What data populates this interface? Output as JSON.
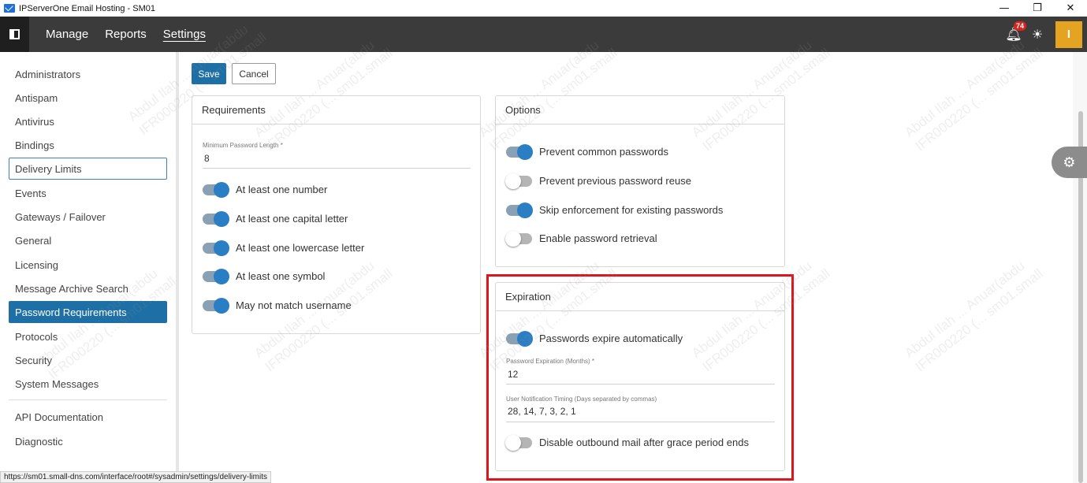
{
  "window": {
    "title": "IPServerOne Email Hosting - SM01",
    "minimize_glyph": "—",
    "maximize_glyph": "❐",
    "close_glyph": "✕"
  },
  "topnav": {
    "items": [
      {
        "label": "Manage"
      },
      {
        "label": "Reports"
      },
      {
        "label": "Settings",
        "active": true
      }
    ],
    "notification_count": "74",
    "avatar_initial": "I"
  },
  "sidebar": {
    "items": [
      {
        "label": "Administrators"
      },
      {
        "label": "Antispam"
      },
      {
        "label": "Antivirus"
      },
      {
        "label": "Bindings"
      },
      {
        "label": "Delivery Limits",
        "hovered": true
      },
      {
        "label": "Events"
      },
      {
        "label": "Gateways / Failover"
      },
      {
        "label": "General"
      },
      {
        "label": "Licensing"
      },
      {
        "label": "Message Archive Search"
      },
      {
        "label": "Password Requirements",
        "active": true
      },
      {
        "label": "Protocols"
      },
      {
        "label": "Security"
      },
      {
        "label": "System Messages"
      },
      {
        "label": "API Documentation"
      },
      {
        "label": "Diagnostic"
      }
    ]
  },
  "toolbar": {
    "save_label": "Save",
    "cancel_label": "Cancel"
  },
  "requirements": {
    "title": "Requirements",
    "min_length_label": "Minimum Password Length *",
    "min_length_value": "8",
    "toggles": [
      {
        "label": "At least one number",
        "on": true
      },
      {
        "label": "At least one capital letter",
        "on": true
      },
      {
        "label": "At least one lowercase letter",
        "on": true
      },
      {
        "label": "At least one symbol",
        "on": true
      },
      {
        "label": "May not match username",
        "on": true
      }
    ]
  },
  "options": {
    "title": "Options",
    "toggles": [
      {
        "label": "Prevent common passwords",
        "on": true
      },
      {
        "label": "Prevent previous password reuse",
        "on": false
      },
      {
        "label": "Skip enforcement for existing passwords",
        "on": true
      },
      {
        "label": "Enable password retrieval",
        "on": false
      }
    ]
  },
  "expiration": {
    "title": "Expiration",
    "auto_expire_label": "Passwords expire automatically",
    "auto_expire_on": true,
    "months_label": "Password Expiration (Months) *",
    "months_value": "12",
    "notify_label": "User Notification Timing (Days separated by commas)",
    "notify_value": "28, 14, 7, 3, 2, 1",
    "disable_outbound_label": "Disable outbound mail after grace period ends",
    "disable_outbound_on": false
  },
  "watermark_text": "Abdul Ilah ... Anuar(abdu\nIFR000220 (... sm01.small",
  "statusbar": {
    "url": "https://sm01.small-dns.com/interface/root#/sysadmin/settings/delivery-limits"
  },
  "colors": {
    "accent": "#1d6fa6",
    "nav_bg": "#3b3b3b",
    "toggle_on": "#2a7ec4",
    "avatar": "#e4a321",
    "highlight": "#e0141b"
  }
}
